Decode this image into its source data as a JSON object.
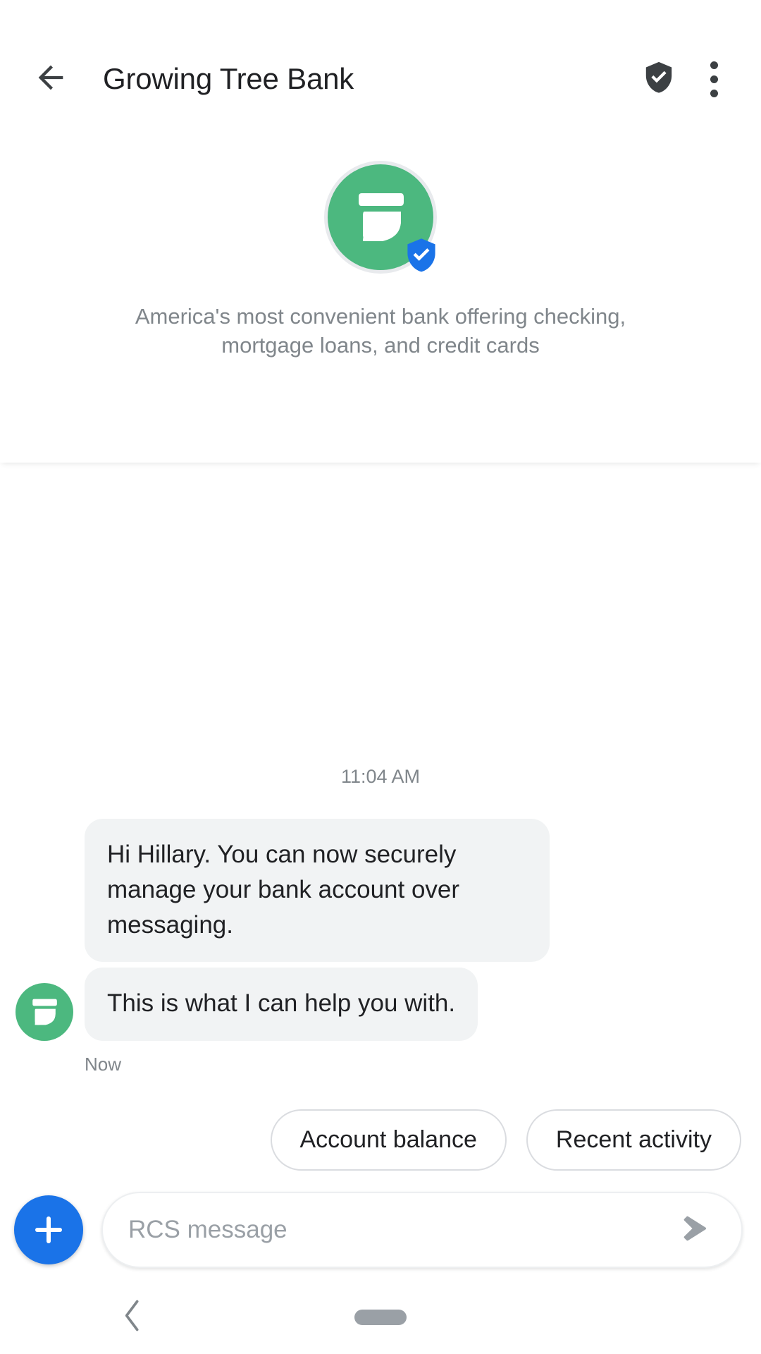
{
  "appbar": {
    "back_icon": "arrow-left-icon",
    "title": "Growing Tree Bank",
    "verified_icon": "shield-check-icon",
    "overflow_icon": "more-vertical-icon"
  },
  "brand": {
    "avatar_icon": "leaf-logo-icon",
    "verified_badge_icon": "verified-shield-icon",
    "description": "America's most convenient bank offering checking, mortgage loans, and credit cards",
    "avatar_color": "#4CB87F",
    "badge_color": "#1A73E8",
    "ring_color": "#E8EAED"
  },
  "thread": {
    "timestamp": "11:04 AM",
    "messages": [
      {
        "text": "Hi Hillary. You can now securely manage your bank account over messaging."
      },
      {
        "text": "This is what I can help you with."
      }
    ],
    "delivery_status": "Now",
    "bubble_color": "#F1F3F4",
    "sender_avatar_icon": "leaf-logo-icon"
  },
  "suggestions": {
    "chips": [
      {
        "label": "Account balance"
      },
      {
        "label": "Recent activity"
      }
    ]
  },
  "composer": {
    "attach_icon": "plus-icon",
    "placeholder": "RCS message",
    "value": "",
    "send_icon": "send-arrow-icon",
    "attach_color": "#1A73E8"
  },
  "navbar": {
    "back_icon": "chevron-left-icon",
    "home_icon": "home-pill-icon"
  }
}
